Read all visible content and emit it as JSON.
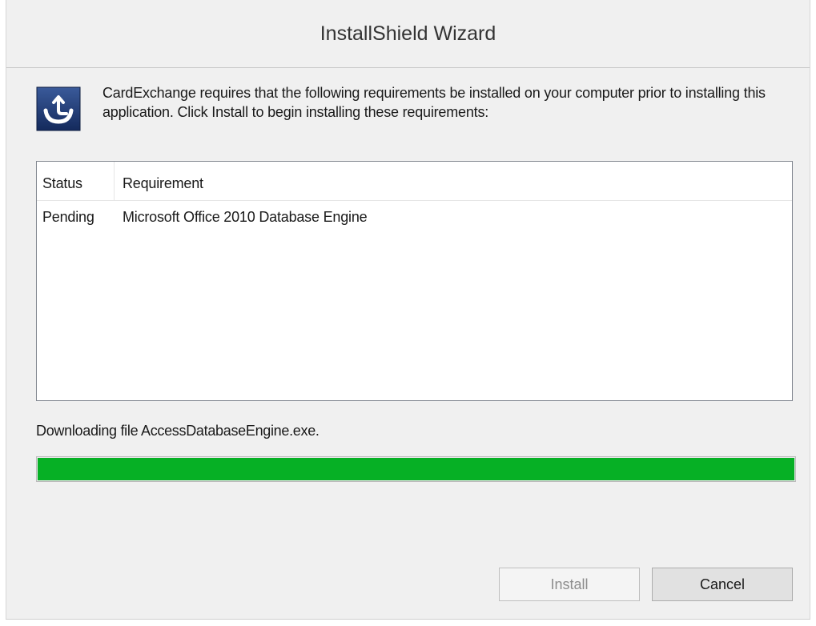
{
  "window": {
    "title": "InstallShield Wizard"
  },
  "intro": {
    "icon": "installshield-setup-icon",
    "text": "CardExchange requires that the following requirements be installed on your computer prior to installing this application. Click Install to begin installing these requirements:"
  },
  "requirements_table": {
    "columns": [
      "Status",
      "Requirement"
    ],
    "rows": [
      {
        "status": "Pending",
        "requirement": "Microsoft Office 2010 Database Engine"
      }
    ]
  },
  "status": {
    "message": "Downloading file AccessDatabaseEngine.exe.",
    "progress": 1.0,
    "progress_color": "#06b025"
  },
  "buttons": {
    "install_label": "Install",
    "install_enabled": false,
    "cancel_label": "Cancel"
  }
}
